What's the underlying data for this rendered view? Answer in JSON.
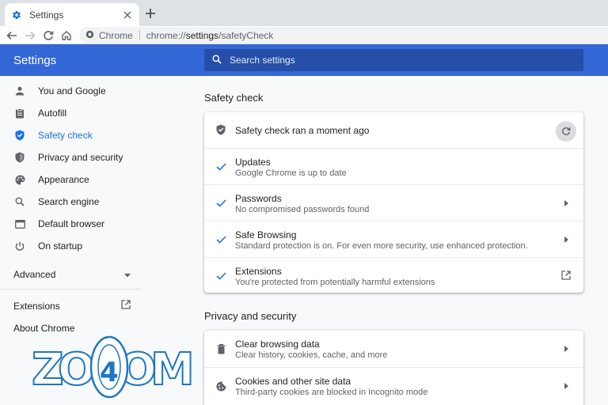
{
  "tab": {
    "title": "Settings",
    "favicon": "gear-icon",
    "close": "close-icon"
  },
  "toolbar": {
    "site_chip": "Chrome",
    "url_prefix": "chrome://",
    "url_host": "settings",
    "url_path": "/safetyCheck"
  },
  "header": {
    "title": "Settings",
    "search_placeholder": "Search settings"
  },
  "sidebar": {
    "items": [
      {
        "label": "You and Google",
        "icon": "person-icon"
      },
      {
        "label": "Autofill",
        "icon": "clipboard-icon"
      },
      {
        "label": "Safety check",
        "icon": "shield-check-icon"
      },
      {
        "label": "Privacy and security",
        "icon": "shield-icon"
      },
      {
        "label": "Appearance",
        "icon": "palette-icon"
      },
      {
        "label": "Search engine",
        "icon": "search-icon"
      },
      {
        "label": "Default browser",
        "icon": "browser-icon"
      },
      {
        "label": "On startup",
        "icon": "power-icon"
      }
    ],
    "advanced": "Advanced",
    "extensions": "Extensions",
    "about": "About Chrome"
  },
  "safety": {
    "title": "Safety check",
    "status": "Safety check ran a moment ago",
    "rows": [
      {
        "title": "Updates",
        "desc": "Google Chrome is up to date"
      },
      {
        "title": "Passwords",
        "desc": "No compromised passwords found"
      },
      {
        "title": "Safe Browsing",
        "desc": "Standard protection is on. For even more security, use enhanced protection."
      },
      {
        "title": "Extensions",
        "desc": "You're protected from potentially harmful extensions"
      }
    ]
  },
  "privacy": {
    "title": "Privacy and security",
    "rows": [
      {
        "title": "Clear browsing data",
        "desc": "Clear history, cookies, cache, and more"
      },
      {
        "title": "Cookies and other site data",
        "desc": "Third-party cookies are blocked in Incognito mode"
      }
    ]
  },
  "watermark": {
    "text": "ZOOM",
    "digit": "4"
  },
  "colors": {
    "accent": "#1a73e8",
    "header": "#3367d6",
    "search_bg": "#254fa8",
    "watermark": "#1d77c2"
  }
}
